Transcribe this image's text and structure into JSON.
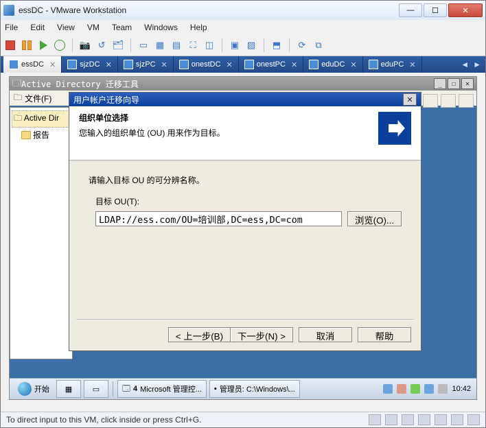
{
  "vmware": {
    "title": "essDC - VMware Workstation",
    "menu": [
      "File",
      "Edit",
      "View",
      "VM",
      "Team",
      "Windows",
      "Help"
    ],
    "status": "To direct input to this VM, click inside or press Ctrl+G."
  },
  "tabs": [
    {
      "label": "essDC",
      "active": true
    },
    {
      "label": "sjzDC",
      "active": false
    },
    {
      "label": "sjzPC",
      "active": false
    },
    {
      "label": "onestDC",
      "active": false
    },
    {
      "label": "onestPC",
      "active": false
    },
    {
      "label": "eduDC",
      "active": false
    },
    {
      "label": "eduPC",
      "active": false
    }
  ],
  "adwin": {
    "title": "Active Directory 迁移工具",
    "file_menu": "文件(F)"
  },
  "tree": {
    "root": "Active Dir",
    "child": "报告"
  },
  "wizard": {
    "title": "用户帐户迁移向导",
    "heading": "组织单位选择",
    "subheading": "您输入的组织单位 (OU) 用来作为目标。",
    "prompt": "请输入目标 OU 的可分辨名称。",
    "target_label": "目标 OU(T):",
    "target_value": "LDAP://ess.com/OU=培训部,DC=ess,DC=com",
    "browse": "浏览(O)...",
    "back": "< 上一步(B)",
    "next": "下一步(N) >",
    "cancel": "取消",
    "help": "帮助"
  },
  "taskbar": {
    "start": "开始",
    "app_count": "4",
    "app1": "Microsoft 管理控...",
    "app2": "管理员: C:\\Windows\\...",
    "clock": "10:42"
  }
}
